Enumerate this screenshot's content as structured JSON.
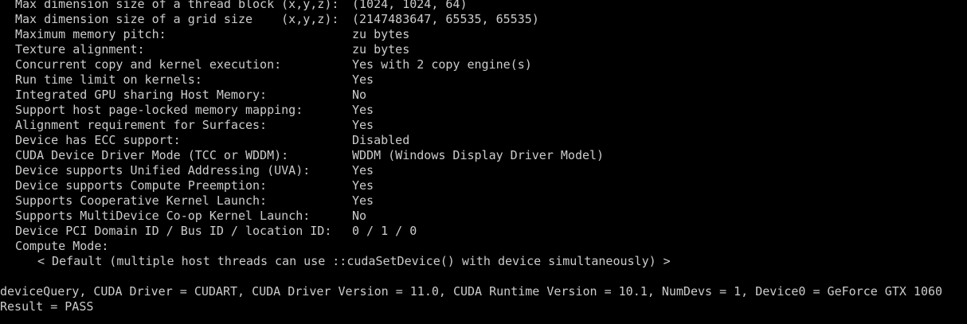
{
  "console": {
    "properties": [
      {
        "label": "Max dimension size of a thread block (x,y,z):",
        "value": "(1024, 1024, 64)"
      },
      {
        "label": "Max dimension size of a grid size    (x,y,z):",
        "value": "(2147483647, 65535, 65535)"
      },
      {
        "label": "Maximum memory pitch:",
        "value": "zu bytes"
      },
      {
        "label": "Texture alignment:",
        "value": "zu bytes"
      },
      {
        "label": "Concurrent copy and kernel execution:",
        "value": "Yes with 2 copy engine(s)"
      },
      {
        "label": "Run time limit on kernels:",
        "value": "Yes"
      },
      {
        "label": "Integrated GPU sharing Host Memory:",
        "value": "No"
      },
      {
        "label": "Support host page-locked memory mapping:",
        "value": "Yes"
      },
      {
        "label": "Alignment requirement for Surfaces:",
        "value": "Yes"
      },
      {
        "label": "Device has ECC support:",
        "value": "Disabled"
      },
      {
        "label": "CUDA Device Driver Mode (TCC or WDDM):",
        "value": "WDDM (Windows Display Driver Model)"
      },
      {
        "label": "Device supports Unified Addressing (UVA):",
        "value": "Yes"
      },
      {
        "label": "Device supports Compute Preemption:",
        "value": "Yes"
      },
      {
        "label": "Supports Cooperative Kernel Launch:",
        "value": "Yes"
      },
      {
        "label": "Supports MultiDevice Co-op Kernel Launch:",
        "value": "No"
      },
      {
        "label": "Device PCI Domain ID / Bus ID / location ID:",
        "value": "0 / 1 / 0"
      }
    ],
    "compute_mode_label": "Compute Mode:",
    "compute_mode_value": "< Default (multiple host threads can use ::cudaSetDevice() with device simultaneously) >",
    "summary_line": "deviceQuery, CUDA Driver = CUDART, CUDA Driver Version = 11.0, CUDA Runtime Version = 10.1, NumDevs = 1, Device0 = GeForce GTX 1060",
    "result_line": "Result = PASS"
  }
}
